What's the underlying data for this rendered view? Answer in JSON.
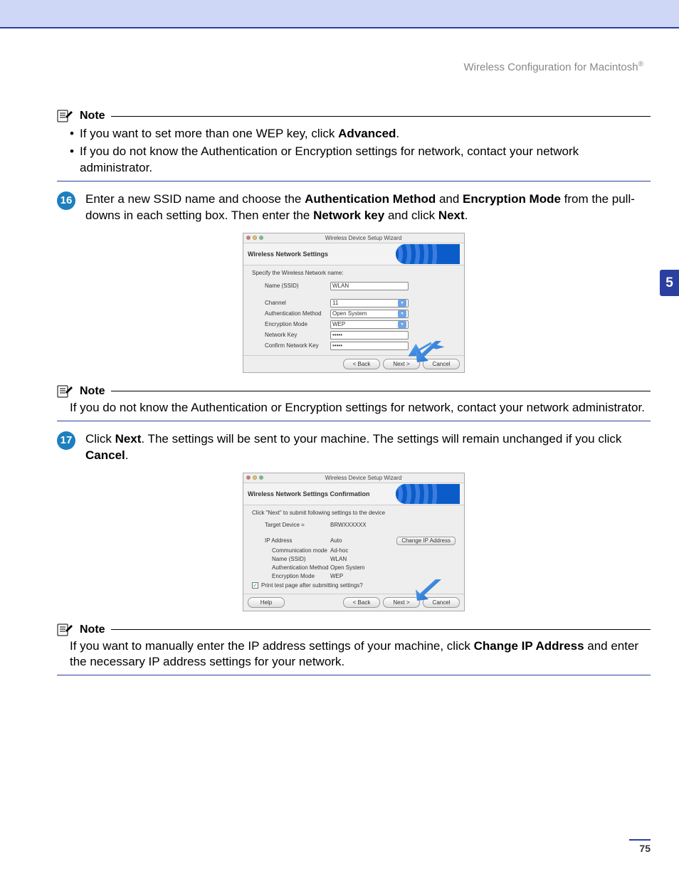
{
  "header": {
    "text": "Wireless Configuration for Macintosh",
    "reg": "®"
  },
  "chapter_tab": "5",
  "page_number": "75",
  "note_label": "Note",
  "note1": {
    "bullets": [
      {
        "pre": "If you want to set more than one WEP key, click ",
        "bold": "Advanced",
        "post": "."
      },
      {
        "pre": "If you do not know the Authentication or Encryption settings for network, contact your network administrator.",
        "bold": "",
        "post": ""
      }
    ]
  },
  "step16": {
    "num": "16",
    "t1": "Enter a new SSID name and choose the ",
    "b1": "Authentication Method",
    "t2": " and ",
    "b2": "Encryption Mode",
    "t3": " from the pull-downs in each setting box. Then enter the ",
    "b3": "Network key",
    "t4": " and click ",
    "b4": "Next",
    "t5": "."
  },
  "wizard1": {
    "title": "Wireless Device Setup Wizard",
    "heading": "Wireless Network Settings",
    "instr": "Specify the Wireless Network name:",
    "rows": {
      "name_lbl": "Name (SSID)",
      "name_val": "WLAN",
      "channel_lbl": "Channel",
      "channel_val": "11",
      "auth_lbl": "Authentication Method",
      "auth_val": "Open System",
      "enc_lbl": "Encryption Mode",
      "enc_val": "WEP",
      "key_lbl": "Network Key",
      "key_val": "•••••",
      "ckey_lbl": "Confirm Network Key",
      "ckey_val": "•••••"
    },
    "back": "< Back",
    "next": "Next >",
    "cancel": "Cancel"
  },
  "note2": {
    "text": "If you do not know the Authentication or Encryption settings for network, contact your network administrator."
  },
  "step17": {
    "num": "17",
    "t1": "Click ",
    "b1": "Next",
    "t2": ". The settings will be sent to your machine. The settings will remain unchanged if you click ",
    "b2": "Cancel",
    "t3": "."
  },
  "wizard2": {
    "title": "Wireless Device Setup Wizard",
    "heading": "Wireless Network Settings Confirmation",
    "instr": "Click \"Next\" to submit following settings to the device",
    "rows": {
      "target_lbl": "Target Device =",
      "target_val": "BRWXXXXXX",
      "ip_lbl": "IP Address",
      "ip_val": "Auto",
      "comm_lbl": "Communication mode",
      "comm_val": "Ad-hoc",
      "name_lbl": "Name (SSID)",
      "name_val": "WLAN",
      "auth_lbl": "Authentication Method",
      "auth_val": "Open System",
      "enc_lbl": "Encryption Mode",
      "enc_val": "WEP"
    },
    "change_ip": "Change IP Address",
    "print_test": "Print test page after submitting settings?",
    "help": "Help",
    "back": "< Back",
    "next": "Next >",
    "cancel": "Cancel"
  },
  "note3": {
    "t1": "If you want to manually enter the IP address settings of your machine, click ",
    "b1": "Change IP Address",
    "t2": " and enter the necessary IP address settings for your network."
  }
}
